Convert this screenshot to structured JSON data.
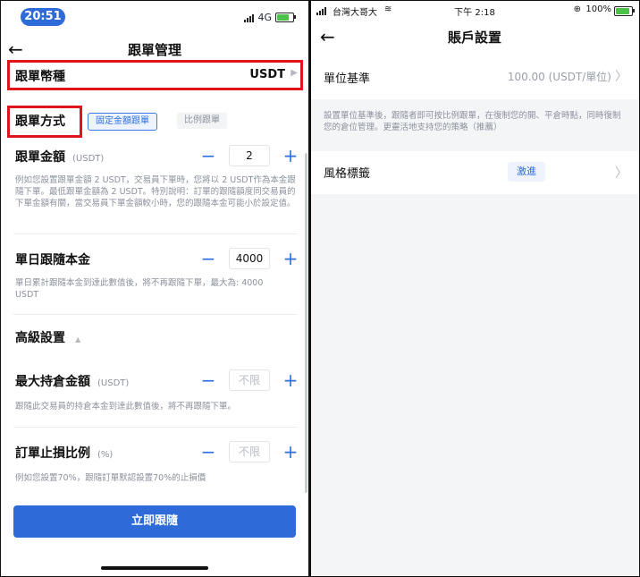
{
  "left": {
    "status": {
      "time": "20:51",
      "network": "4G"
    },
    "nav": {
      "title": "跟單管理"
    },
    "currency": {
      "label": "跟單幣種",
      "value": "USDT"
    },
    "method": {
      "label": "跟單方式",
      "tabs": [
        "固定金額跟單",
        "比例跟單"
      ],
      "active_tab": 0
    },
    "amount": {
      "label": "跟單金額",
      "unit": "(USDT)",
      "value": "2",
      "desc": "例如您設置跟單金額 2 USDT，交易員下單時，您將以 2 USDT作為本金跟隨下單。最低跟單金額為 2 USDT。特別說明：訂單的跟隨額度同交易員的下單金額有關，當交易員下單金額較小時，您的跟隨本金可能小於設定值。"
    },
    "daily": {
      "label": "單日跟隨本金",
      "value": "4000",
      "desc": "單日累計跟隨本金到達此數值後，將不再跟隨下單，最大為: 4000 USDT"
    },
    "advanced": {
      "label": "高級設置"
    },
    "max_hold": {
      "label": "最大持倉金額",
      "unit": "(USDT)",
      "placeholder": "不限",
      "desc": "跟隨此交易員的持倉本金到達此數值後，將不再跟隨下單。"
    },
    "stop_loss": {
      "label": "訂單止損比例",
      "unit": "(%)",
      "placeholder": "不限",
      "desc": "例如您設置70%，跟隨訂單默認設置70%的止損價"
    },
    "follow_button": "立即跟隨"
  },
  "right": {
    "status": {
      "carrier": "台灣大哥大",
      "time": "下午 2:18",
      "battery": "100%"
    },
    "nav": {
      "title": "賬戶設置"
    },
    "unit_base": {
      "label": "單位基準",
      "value": "100.00 (USDT/單位)"
    },
    "unit_desc": "設置單位基準後，跟隨者即可按比例跟單，在復制您的開、平倉時點，同時復制您的倉位管理。更靈活地支持您的策略（推薦）",
    "style": {
      "label": "風格標籤",
      "value": "激進"
    }
  },
  "colors": {
    "accent": "#2e6bd8",
    "highlight_box": "#e0141b"
  }
}
